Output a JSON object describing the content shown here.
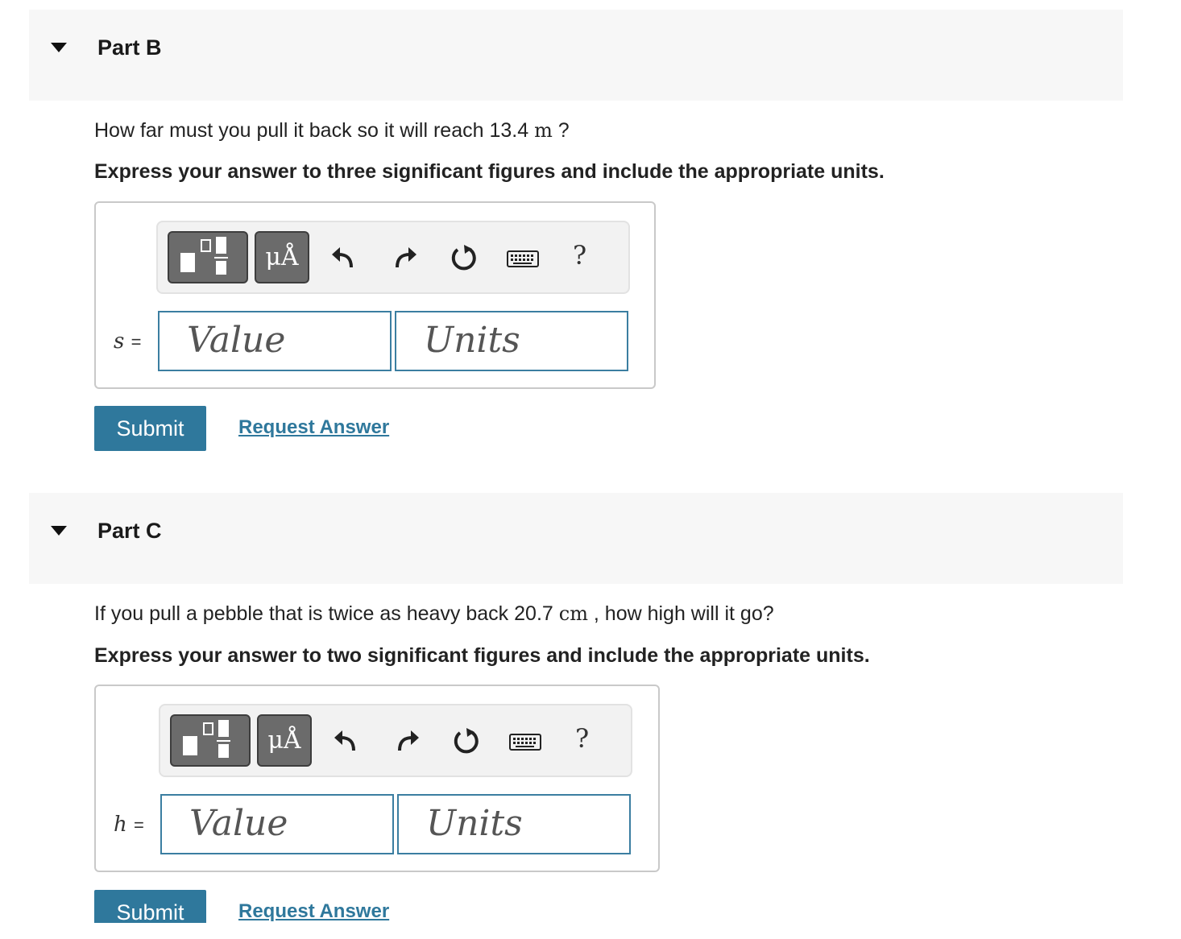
{
  "parts": [
    {
      "title": "Part B",
      "question_pre": "How far must you pull it back so it will reach 13.4",
      "question_unit": "m",
      "question_post": " ?",
      "instruction": "Express your answer to three significant figures and include the appropriate units.",
      "variable": "s",
      "equals": "=",
      "value_placeholder": "Value",
      "units_placeholder": "Units",
      "submit_label": "Submit",
      "request_label": "Request Answer"
    },
    {
      "title": "Part C",
      "question_pre": "If you pull a pebble that is twice as heavy back 20.7",
      "question_unit": "cm",
      "question_post": " , how high will it go?",
      "instruction": "Express your answer to two significant figures and include the appropriate units.",
      "variable": "h",
      "equals": "=",
      "value_placeholder": "Value",
      "units_placeholder": "Units",
      "submit_label": "Submit",
      "request_label": "Request Answer"
    }
  ],
  "toolbar": {
    "units_button_label": "μÅ",
    "help_label": "?",
    "icons": [
      "templates-icon",
      "units-icon",
      "undo-icon",
      "redo-icon",
      "reset-icon",
      "keyboard-icon",
      "help-icon"
    ]
  },
  "colors": {
    "accent": "#2f789c",
    "input_border": "#3b7ea1",
    "header_bg": "#f7f7f7",
    "toolbar_button": "#6b6b6b"
  }
}
